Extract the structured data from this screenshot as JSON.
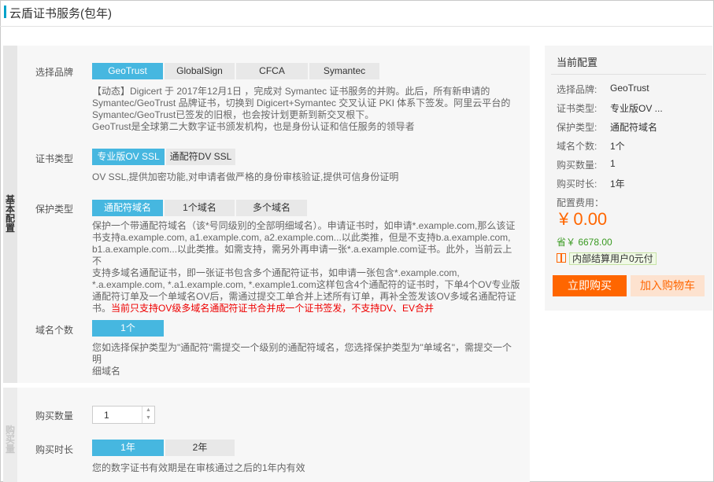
{
  "page": {
    "title": "云盾证书服务(包年)"
  },
  "section_basic": {
    "tab_label": "基本配置"
  },
  "section_purchase": {
    "tab_label": "购买量"
  },
  "brand": {
    "label": "选择品牌",
    "options": [
      "GeoTrust",
      "GlobalSign",
      "CFCA",
      "Symantec"
    ],
    "selected": "GeoTrust",
    "desc_lines": [
      "【动态】Digicert 于 2017年12月1日 ，完成对 Symantec 证书服务的并购。此后，所有新申请的",
      "Symantec/GeoTrust 品牌证书，切换到 Digicert+Symantec 交叉认证 PKI 体系下签发。阿里云平台的",
      "Symantec/GeoTrust已签发的旧根，也会按计划更新到新交叉根下。",
      "GeoTrust是全球第二大数字证书颁发机构，也是身份认证和信任服务的领导者"
    ]
  },
  "cert_type": {
    "label": "证书类型",
    "options": [
      "专业版OV SSL",
      "通配符DV SSL"
    ],
    "selected": "专业版OV SSL",
    "desc": "OV SSL,提供加密功能,对申请者做严格的身份审核验证,提供可信身份证明"
  },
  "protect_type": {
    "label": "保护类型",
    "options": [
      "通配符域名",
      "1个域名",
      "多个域名"
    ],
    "selected": "通配符域名",
    "desc_lines": [
      "保护一个带通配符域名（该*号同级别的全部明细域名）。申请证书时，如申请*.example.com,那么该证",
      "书支持a.example.com, a1.example.com, a2.example.com...以此类推，但是不支持b.a.example.com,",
      "b1.a.example.com...以此类推。如需支持，需另外再申请一张*.a.example.com证书。此外，当前云上不",
      "支持多域名通配证书，即一张证书包含多个通配符证书，如申请一张包含*.example.com,",
      "*.a.example.com, *.a1.example.com, *.example1.com这样包含4个通配符的证书时，下单4个OV专业版",
      "通配符订单及一个单域名OV后，需通过提交工单合并上述所有订单，再补全签发该OV多域名通配符证"
    ],
    "desc_last_prefix": "书。",
    "desc_warning": "当前只支持OV级多域名通配符证书合并成一个证书签发，不支持DV、EV合并"
  },
  "domain_count": {
    "label": "域名个数",
    "options": [
      "1个"
    ],
    "selected": "1个",
    "desc_lines": [
      "您如选择保护类型为\"通配符\"需提交一个级别的通配符域名，您选择保护类型为\"单域名\"，需提交一个明",
      "细域名"
    ]
  },
  "quantity": {
    "label": "购买数量",
    "value": "1"
  },
  "duration": {
    "label": "购买时长",
    "options": [
      "1年",
      "2年"
    ],
    "selected": "1年",
    "desc": "您的数字证书有效期是在审核通过之后的1年内有效"
  },
  "summary": {
    "title": "当前配置",
    "rows": [
      {
        "key": "选择品牌:",
        "value": "GeoTrust"
      },
      {
        "key": "证书类型:",
        "value": "专业版OV ..."
      },
      {
        "key": "保护类型:",
        "value": "通配符域名"
      },
      {
        "key": "域名个数:",
        "value": "1个"
      },
      {
        "key": "购买数量:",
        "value": "1"
      },
      {
        "key": "购买时长:",
        "value": "1年"
      }
    ],
    "fee_label": "配置费用：",
    "price": "¥ 0.00",
    "save_text": "省￥ 6678.00",
    "promo_text": "内部结算用户0元付",
    "buy_label": "立即购买",
    "cart_label": "加入购物车"
  },
  "colors": {
    "accent": "#46b7e0",
    "brand_orange": "#ff6600",
    "warning": "#ee0000",
    "save_green": "#3a9a22"
  }
}
